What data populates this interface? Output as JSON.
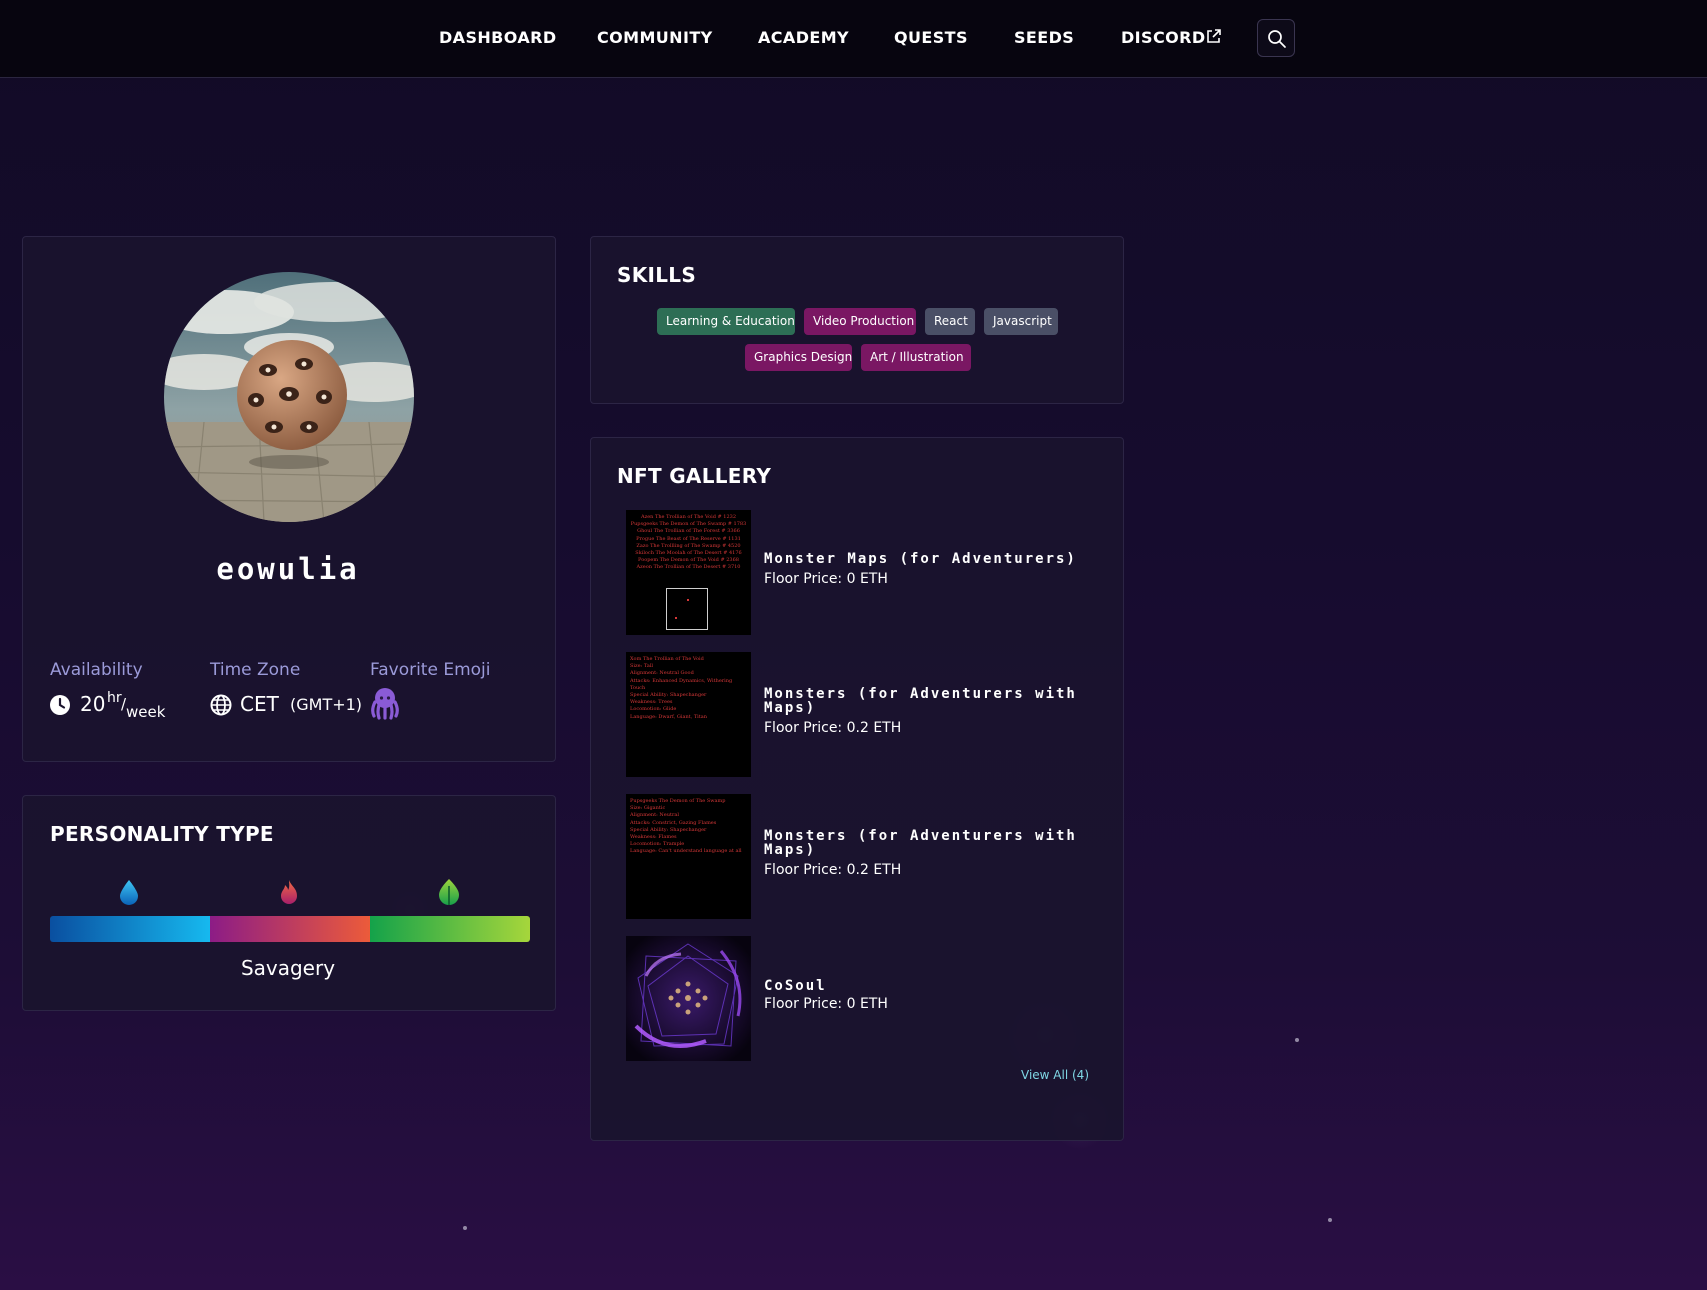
{
  "nav": {
    "items": [
      "DASHBOARD",
      "COMMUNITY",
      "ACADEMY",
      "QUESTS",
      "SEEDS",
      "DISCORD"
    ]
  },
  "profile": {
    "username": "eowulia",
    "availability": {
      "label": "Availability",
      "value": "20",
      "unit_top": "hr",
      "unit_bottom": "week"
    },
    "timezone": {
      "label": "Time Zone",
      "value": "CET",
      "offset": "(GMT+1)"
    },
    "emoji": {
      "label": "Favorite Emoji",
      "icon": "octopus-icon"
    }
  },
  "personality": {
    "title": "PERSONALITY TYPE",
    "type_name": "Savagery",
    "segments": [
      {
        "icon": "water-drop-icon",
        "colors": [
          "#0a4fa0",
          "#16b9ef"
        ]
      },
      {
        "icon": "fire-icon",
        "colors": [
          "#8c1c86",
          "#ec5b3a"
        ]
      },
      {
        "icon": "leaf-icon",
        "colors": [
          "#14a24a",
          "#a6d63b"
        ]
      }
    ]
  },
  "skills": {
    "title": "SKILLS",
    "tags": [
      {
        "label": "Learning & Education",
        "color": "#2d6e55"
      },
      {
        "label": "Video Production",
        "color": "#7a1763"
      },
      {
        "label": "React",
        "color": "#4a4f66"
      },
      {
        "label": "Javascript",
        "color": "#4a4f66"
      },
      {
        "label": "Graphics Design",
        "color": "#7a1763"
      },
      {
        "label": "Art / Illustration",
        "color": "#7a1763"
      }
    ]
  },
  "nft_gallery": {
    "title": "NFT GALLERY",
    "items": [
      {
        "name": "Monster Maps (for Adventurers)",
        "price": "Floor Price: 0 ETH"
      },
      {
        "name": "Monsters (for Adventurers with Maps)",
        "price": "Floor Price: 0.2 ETH"
      },
      {
        "name": "Monsters (for Adventurers with Maps)",
        "price": "Floor Price: 0.2 ETH"
      },
      {
        "name": "CoSoul",
        "price": "Floor Price: 0 ETH"
      }
    ],
    "view_all": "View All (4)"
  }
}
